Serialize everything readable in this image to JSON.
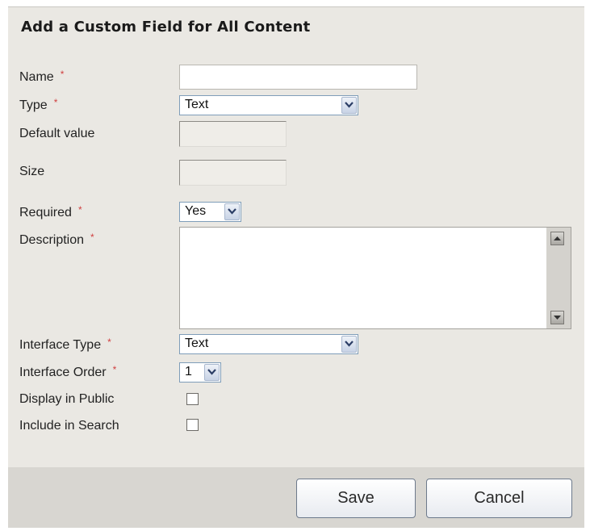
{
  "form": {
    "title": "Add a Custom Field for All Content",
    "required_marker": "*",
    "fields": {
      "name": {
        "label": "Name",
        "value": ""
      },
      "type": {
        "label": "Type",
        "value": "Text"
      },
      "default_value": {
        "label": "Default value",
        "value": ""
      },
      "size": {
        "label": "Size",
        "value": ""
      },
      "required": {
        "label": "Required",
        "value": "Yes"
      },
      "description": {
        "label": "Description",
        "value": ""
      },
      "interface_type": {
        "label": "Interface Type",
        "value": "Text"
      },
      "interface_order": {
        "label": "Interface Order",
        "value": "1"
      },
      "display_in_public": {
        "label": "Display in Public",
        "checked": false
      },
      "include_in_search": {
        "label": "Include in Search",
        "checked": false
      }
    },
    "buttons": {
      "save": "Save",
      "cancel": "Cancel"
    }
  }
}
